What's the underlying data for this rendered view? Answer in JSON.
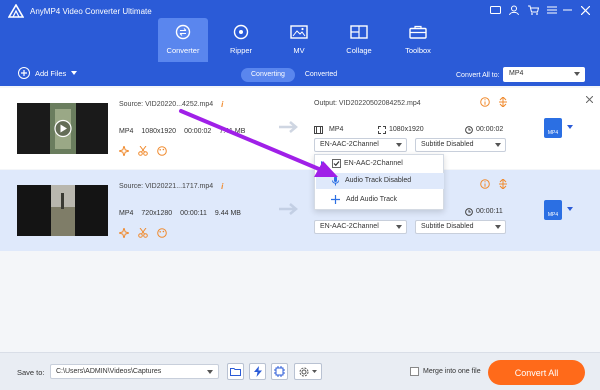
{
  "window": {
    "title": "AnyMP4 Video Converter Ultimate"
  },
  "nav": {
    "tabs": [
      {
        "label": "Converter",
        "icon": "converter-icon"
      },
      {
        "label": "Ripper",
        "icon": "ripper-icon"
      },
      {
        "label": "MV",
        "icon": "mv-icon"
      },
      {
        "label": "Collage",
        "icon": "collage-icon"
      },
      {
        "label": "Toolbox",
        "icon": "toolbox-icon"
      }
    ]
  },
  "toolbar": {
    "add_files": "Add Files",
    "segments": [
      "Converting",
      "Converted"
    ],
    "convert_all_label": "Convert All to:",
    "convert_all_value": "MP4"
  },
  "files": [
    {
      "source": "Source: VID20220...4252.mp4",
      "format": "MP4",
      "resolution": "1080x1920",
      "duration": "00:00:02",
      "size": "7.41 MB",
      "output": "Output: VID20220502084252.mp4",
      "out_format": "MP4",
      "out_resolution": "1080x1920",
      "out_duration": "00:00:02",
      "audio": "EN-AAC-2Channel",
      "subtitle": "Subtitle Disabled",
      "badge": "MP4"
    },
    {
      "source": "Source: VID20221...1717.mp4",
      "format": "MP4",
      "resolution": "720x1280",
      "duration": "00:00:11",
      "size": "9.44 MB",
      "out_duration": "00:00:11",
      "audio": "EN-AAC-2Channel",
      "subtitle": "Subtitle Disabled",
      "badge": "MP4"
    }
  ],
  "audio_menu": {
    "items": [
      "EN-AAC-2Channel",
      "Audio Track Disabled",
      "Add Audio Track"
    ]
  },
  "bottom": {
    "save_label": "Save to:",
    "save_path": "C:\\Users\\ADMIN\\Videos\\Captures",
    "merge_label": "Merge into one file",
    "convert_all": "Convert All"
  },
  "colors": {
    "header": "#2b5bd7",
    "active_tab": "#5a86ee",
    "convert_button": "#ff6a1a",
    "annotation_arrow": "#a020e8",
    "info_icon": "#f08a2d"
  }
}
